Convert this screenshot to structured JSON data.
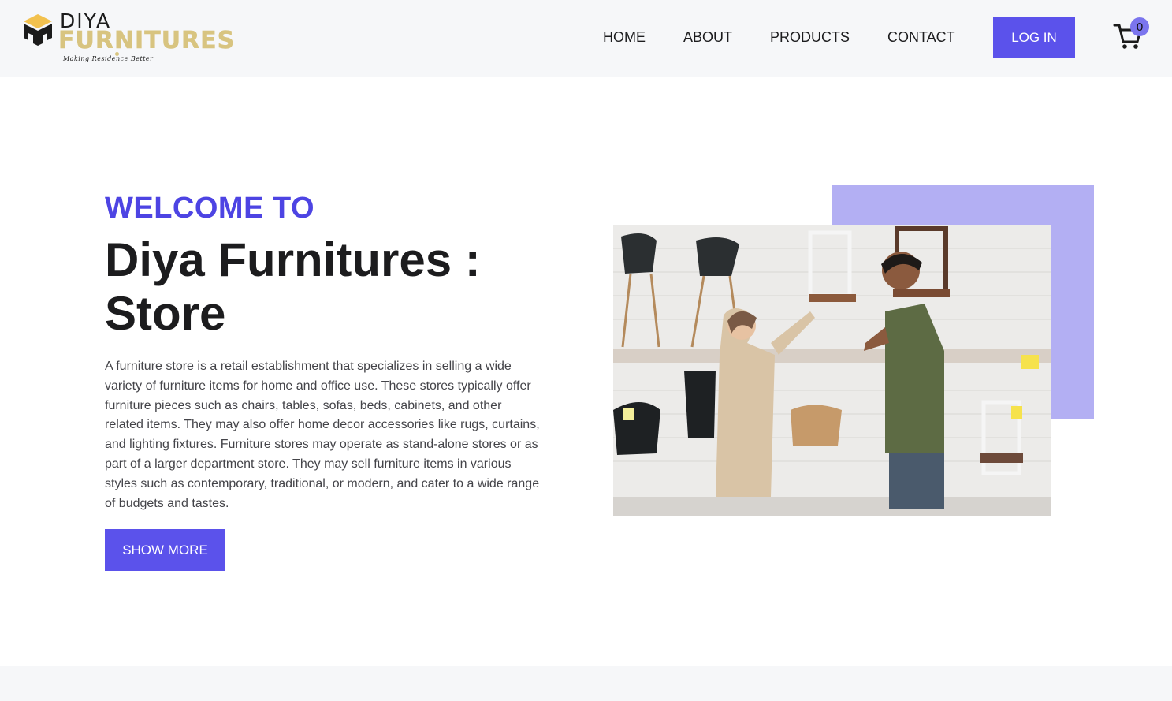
{
  "brand": {
    "line1": "DIYA",
    "line2": "FURNITURES",
    "tagline": "Making Residence Better"
  },
  "nav": {
    "items": [
      {
        "label": "HOME"
      },
      {
        "label": "ABOUT"
      },
      {
        "label": "PRODUCTS"
      },
      {
        "label": "CONTACT"
      }
    ],
    "login_label": "LOG IN",
    "cart_count": "0"
  },
  "hero": {
    "kicker": "WELCOME TO",
    "title": "Diya Furnitures : Store",
    "description": "A furniture store is a retail establishment that specializes in selling a wide variety of furniture items for home and office use. These stores typically offer furniture pieces such as chairs, tables, sofas, beds, cabinets, and other related items. They may also offer home decor accessories like rugs, curtains, and lighting fixtures. Furniture stores may operate as stand-alone stores or as part of a larger department store. They may sell furniture items in various styles such as contemporary, traditional, or modern, and cater to a wide range of budgets and tastes.",
    "button_label": "SHOW MORE"
  },
  "colors": {
    "accent": "#5b52eb",
    "kicker": "#4d44e3",
    "accent_box": "#b3aff3",
    "brand_gold": "#d8c480",
    "header_bg": "#f6f7f9"
  },
  "icons": {
    "logo": "logo-cube-icon",
    "cart": "cart-icon"
  }
}
